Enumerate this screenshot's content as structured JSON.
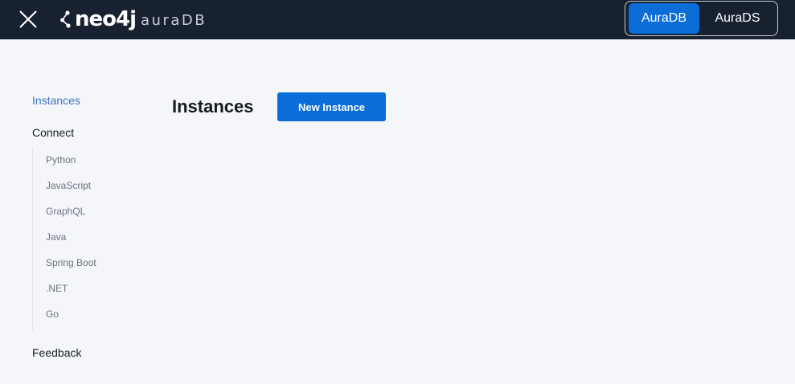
{
  "header": {
    "close_icon": "close-icon",
    "logo": {
      "brand": "neo4j",
      "product": "auraDB"
    },
    "product_switch": [
      {
        "label": "AuraDB",
        "active": true
      },
      {
        "label": "AuraDS",
        "active": false
      }
    ]
  },
  "sidebar": {
    "instances": "Instances",
    "connect": "Connect",
    "connect_items": [
      "Python",
      "JavaScript",
      "GraphQL",
      "Java",
      "Spring Boot",
      ".NET",
      "Go"
    ],
    "feedback": "Feedback"
  },
  "main": {
    "title": "Instances",
    "new_instance_label": "New Instance"
  },
  "colors": {
    "topbar": "#172130",
    "accent": "#0a6dd8",
    "active_nav": "#3e74c6",
    "background": "#f5f6fa"
  }
}
